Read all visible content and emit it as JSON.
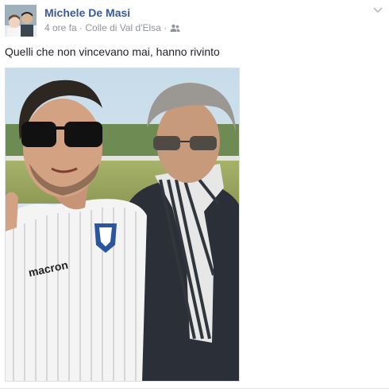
{
  "post": {
    "author": "Michele De Masi",
    "time": "4 ore fa",
    "separator": "·",
    "location": "Colle di Val d'Elsa",
    "privacy_icon": "friends-icon",
    "text": "Quelli che non vincevano mai, hanno rivinto",
    "menu_icon": "chevron-down-icon",
    "shirt_brand": "macron"
  },
  "colors": {
    "author_link": "#3b5998",
    "meta_text": "#90949c",
    "body_text": "#1d2129"
  }
}
